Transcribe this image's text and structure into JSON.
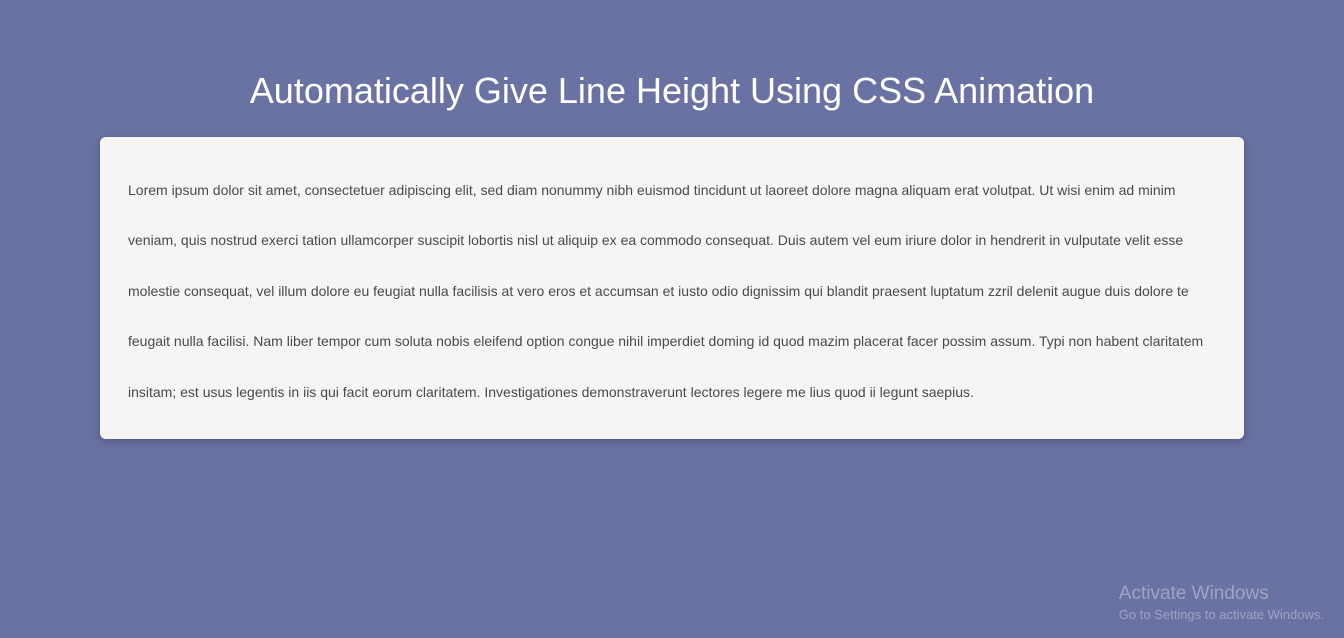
{
  "title": "Automatically Give Line Height Using CSS Animation",
  "body_text": "Lorem ipsum dolor sit amet, consectetuer adipiscing elit, sed diam nonummy nibh euismod tincidunt ut laoreet dolore magna aliquam erat volutpat. Ut wisi enim ad minim veniam, quis nostrud exerci tation ullamcorper suscipit lobortis nisl ut aliquip ex ea commodo consequat. Duis autem vel eum iriure dolor in hendrerit in vulputate velit esse molestie consequat, vel illum dolore eu feugiat nulla facilisis at vero eros et accumsan et iusto odio dignissim qui blandit praesent luptatum zzril delenit augue duis dolore te feugait nulla facilisi. Nam liber tempor cum soluta nobis eleifend option congue nihil imperdiet doming id quod mazim placerat facer possim assum. Typi non habent claritatem insitam; est usus legentis in iis qui facit eorum claritatem. Investigationes demonstraverunt lectores legere me lius quod ii legunt saepius.",
  "watermark": {
    "title": "Activate Windows",
    "sub": "Go to Settings to activate Windows."
  }
}
